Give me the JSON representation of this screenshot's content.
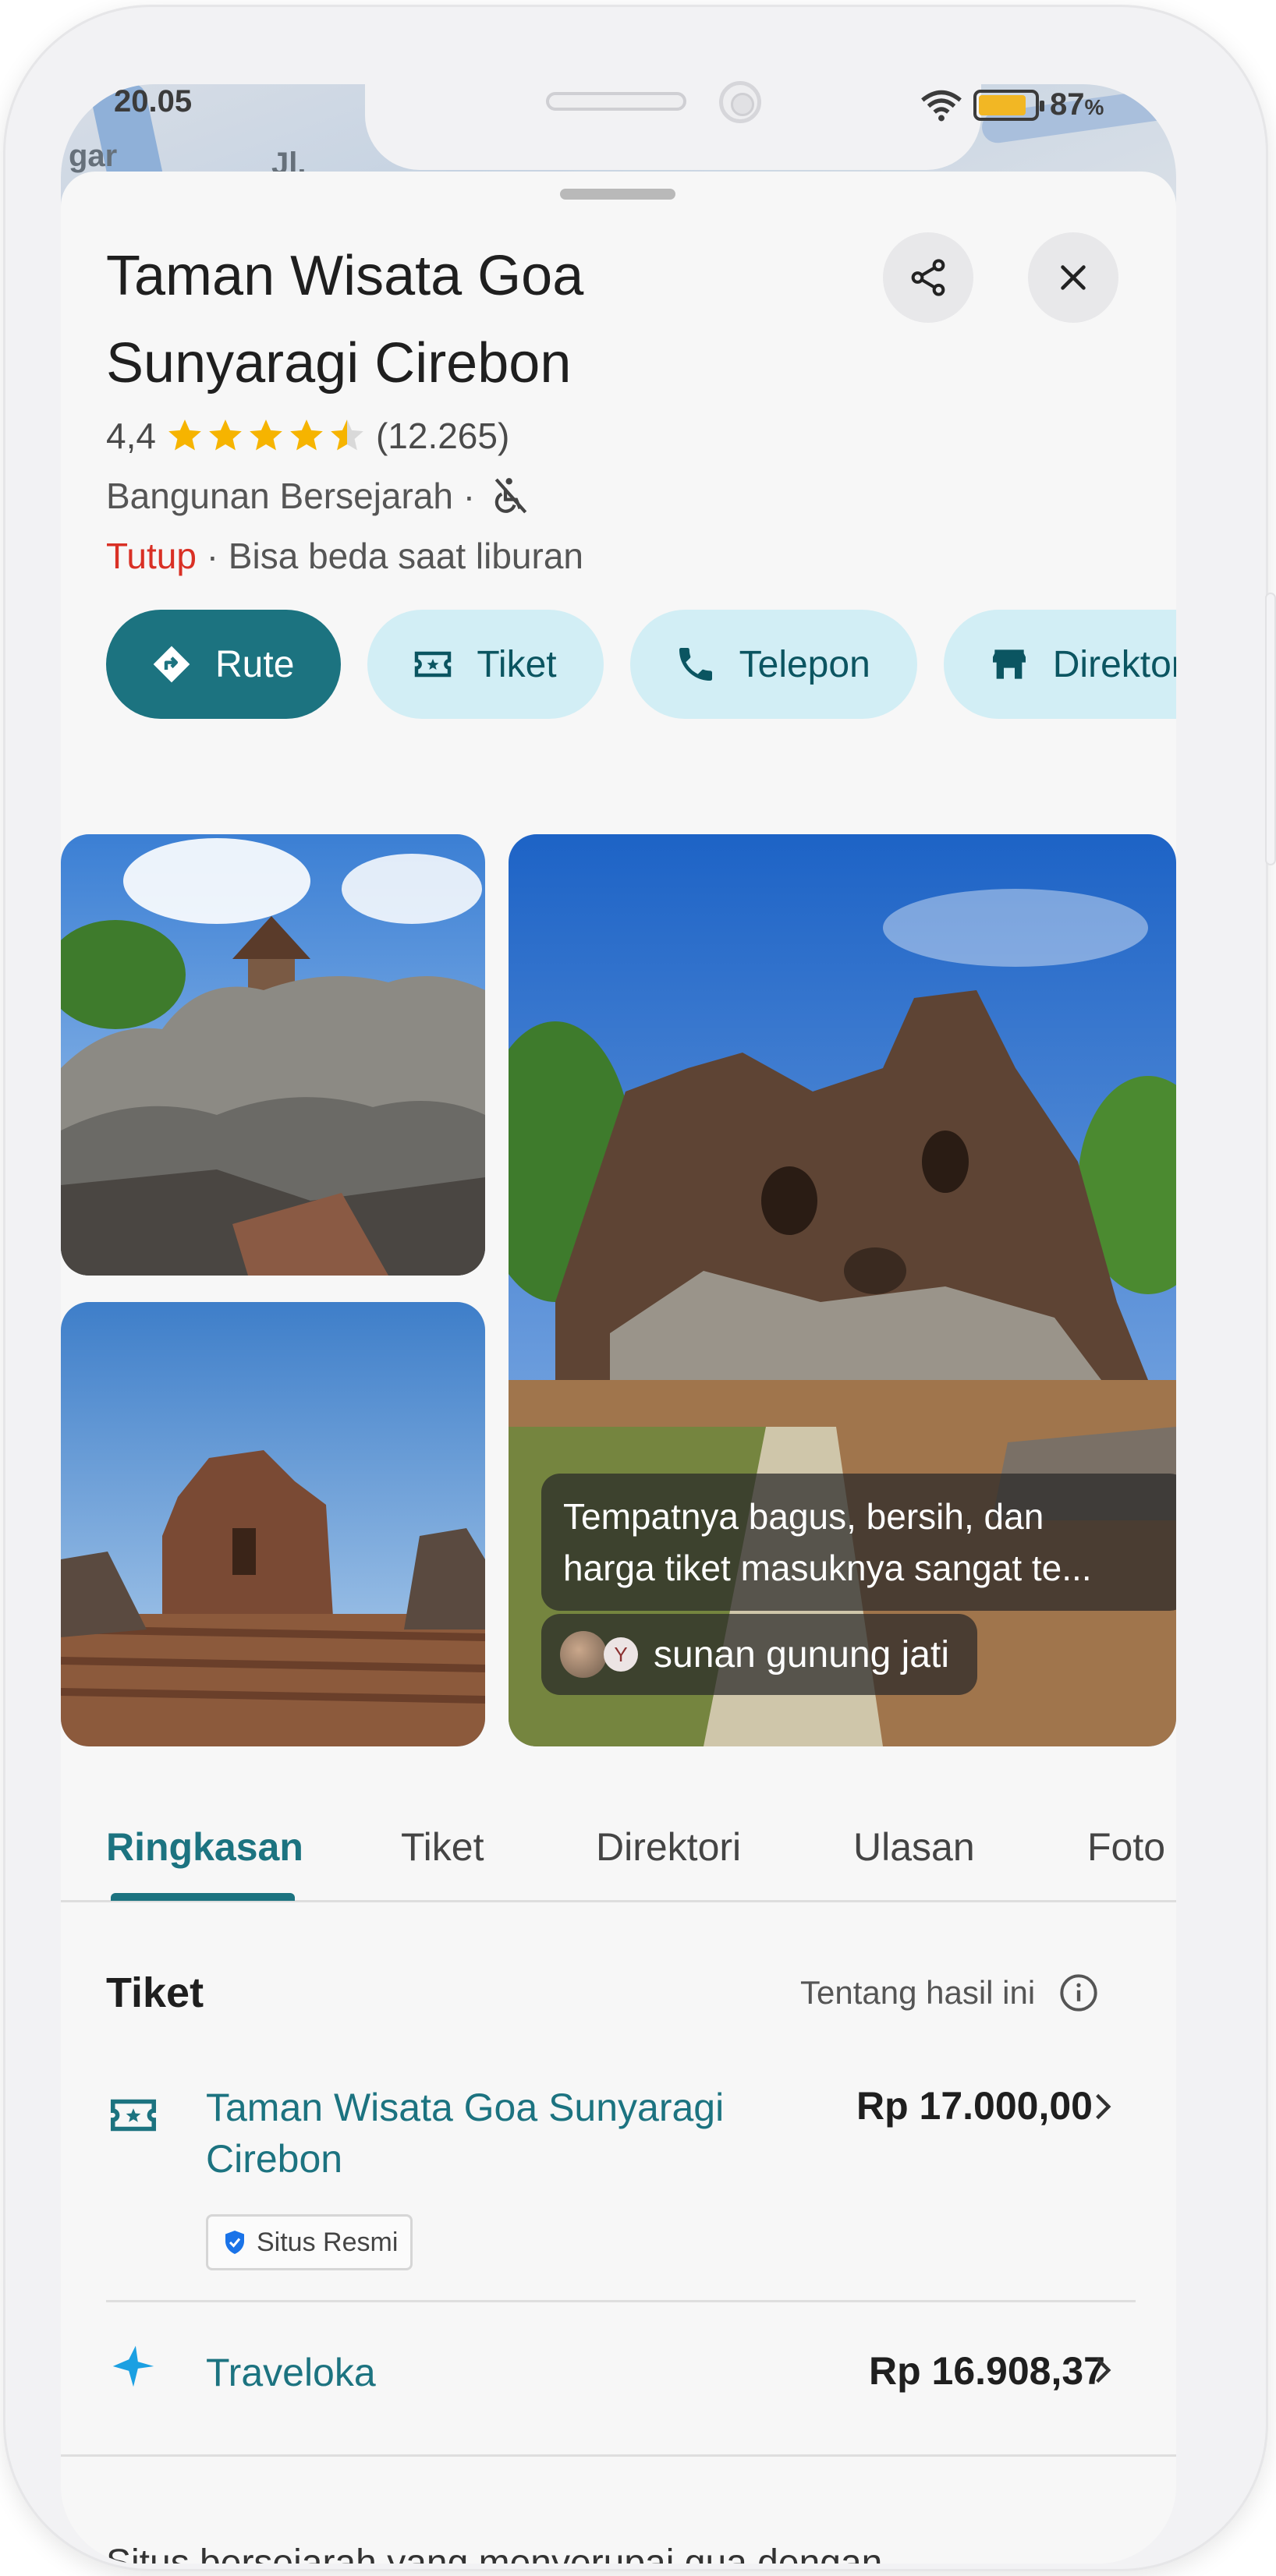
{
  "status_bar": {
    "time": "20.05",
    "battery": "87",
    "battery_unit": "%"
  },
  "map": {
    "street_label_1": "Jl.",
    "street_label_2": "gar"
  },
  "place": {
    "title_line1": "Taman Wisata Goa",
    "title_line2": "Sunyaragi Cirebon",
    "rating": "4,4",
    "rating_value": 4.4,
    "review_count": "(12.265)",
    "category": "Bangunan Bersejarah ·",
    "status_closed": "Tutup",
    "status_note": " · Bisa beda saat liburan"
  },
  "actions": [
    {
      "label": "Rute",
      "icon": "directions-icon"
    },
    {
      "label": "Tiket",
      "icon": "ticket-icon"
    },
    {
      "label": "Telepon",
      "icon": "phone-icon"
    },
    {
      "label": "Direktori",
      "icon": "store-icon"
    }
  ],
  "review_snippet": {
    "line1": "Tempatnya bagus, bersih, dan",
    "line2": "harga tiket masuknya sangat te...",
    "author": "sunan gunung jati",
    "author_initial": "Y"
  },
  "tabs": [
    "Ringkasan",
    "Tiket",
    "Direktori",
    "Ulasan",
    "Foto"
  ],
  "active_tab": "Ringkasan",
  "tickets_section": {
    "heading": "Tiket",
    "about_label": "Tentang hasil ini",
    "offers": [
      {
        "name_line1": "Taman Wisata Goa Sunyaragi",
        "name_line2": "Cirebon",
        "price": "Rp 17.000,00",
        "badge": "Situs Resmi"
      },
      {
        "name_line1": "Traveloka",
        "price": "Rp 16.908,37"
      }
    ]
  },
  "description": "Situs bersejarah yang menyerupai gua dengan",
  "colors": {
    "accent": "#1c7380",
    "chip_bg": "#d2eef5",
    "closed": "#d93025",
    "star": "#f6b400"
  }
}
